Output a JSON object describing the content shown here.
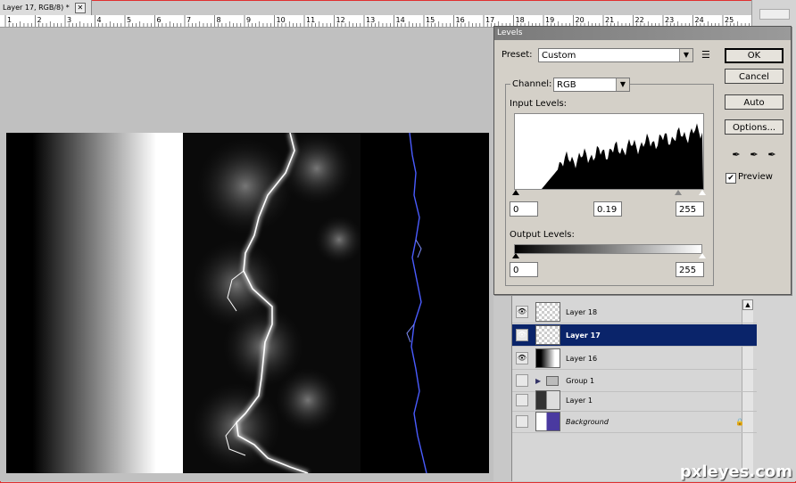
{
  "document": {
    "tab_title": "Layer 17, RGB/8) *",
    "close_glyph": "✕"
  },
  "ruler": {
    "labels": [
      "1",
      "2",
      "3",
      "4",
      "5",
      "6",
      "7",
      "8",
      "9",
      "10",
      "11",
      "12",
      "13",
      "14",
      "15",
      "16",
      "17",
      "18",
      "19",
      "20",
      "21",
      "22",
      "23",
      "24",
      "25"
    ]
  },
  "levels_dialog": {
    "title": "Levels",
    "preset_label": "Preset:",
    "preset_value": "Custom",
    "channel_label": "Channel:",
    "channel_value": "RGB",
    "input_levels_label": "Input Levels:",
    "input_black": "0",
    "input_gamma": "0.19",
    "input_white": "255",
    "output_levels_label": "Output Levels:",
    "output_black": "0",
    "output_white": "255",
    "buttons": {
      "ok": "OK",
      "cancel": "Cancel",
      "auto": "Auto",
      "options": "Options..."
    },
    "preview_label": "Preview",
    "preview_checked": "✔"
  },
  "layers_panel": {
    "layers": [
      {
        "name": "Layer 18",
        "visible": true,
        "selected": false
      },
      {
        "name": "Layer 17",
        "visible": true,
        "selected": true
      },
      {
        "name": "Layer 16",
        "visible": true,
        "selected": false
      },
      {
        "name": "Group 1",
        "visible": false,
        "selected": false
      },
      {
        "name": "Layer 1",
        "visible": false,
        "selected": false
      },
      {
        "name": "Background",
        "visible": false,
        "selected": false
      }
    ],
    "eye_glyph": "👁",
    "lock_glyph": "🔒",
    "group_arrow": "▶"
  },
  "watermark": "pxleyes.com",
  "colors": {
    "selection": "#0a246a",
    "frame": "#e03030",
    "blue_lightning": "#4a5cff"
  }
}
